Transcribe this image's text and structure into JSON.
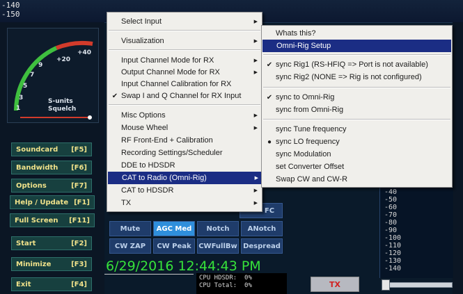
{
  "levels": {
    "top1": "-140",
    "top2": "-150"
  },
  "smeter": {
    "scale": [
      "+20",
      "+40",
      "9",
      "7",
      "5",
      "3",
      "1"
    ],
    "label1": "S-units",
    "label2": "Squelch"
  },
  "leftpanel": {
    "buttons": [
      {
        "label": "Soundcard",
        "key": "[F5]"
      },
      {
        "label": "Bandwidth",
        "key": "[F6]"
      },
      {
        "label": "Options",
        "key": "[F7]"
      },
      {
        "label": "Help / Update",
        "key": "[F1]"
      },
      {
        "label": "Full Screen",
        "key": "[F11]"
      },
      {
        "label": "Start",
        "key": "[F2]"
      },
      {
        "label": "Minimize",
        "key": "[F3]"
      },
      {
        "label": "Exit",
        "key": "[F4]"
      }
    ]
  },
  "midbuttons": {
    "row1": [
      "Mute",
      "AGC Med",
      "Notch",
      "ANotch"
    ],
    "row2": [
      "CW ZAP",
      "CW Peak",
      "CWFullBw",
      "Despread"
    ],
    "partial": "FC"
  },
  "clock": "6/29/2016 12:44:43 PM",
  "cpu": {
    "line1": "CPU HDSDR:  0%",
    "line2": "CPU Total:  0%"
  },
  "tx_label": "TX",
  "scale_ticks": [
    "-40",
    "-50",
    "-60",
    "-70",
    "-80",
    "-90",
    "-100",
    "-110",
    "-120",
    "-130",
    "-140"
  ],
  "main_menu": {
    "items": [
      {
        "label": "Select Input",
        "submenu": true
      },
      {
        "label": "Visualization",
        "submenu": true
      },
      {
        "label": "Input Channel Mode for RX",
        "submenu": true
      },
      {
        "label": "Output Channel Mode for RX",
        "submenu": true
      },
      {
        "label": "Input Channel Calibration for RX",
        "submenu": false
      },
      {
        "label": "Swap I and Q Channel for RX Input",
        "submenu": false,
        "checked": true
      },
      {
        "label": "Misc Options",
        "submenu": true
      },
      {
        "label": "Mouse Wheel",
        "submenu": true
      },
      {
        "label": "RF Front-End + Calibration",
        "submenu": false
      },
      {
        "label": "Recording Settings/Scheduler",
        "submenu": false
      },
      {
        "label": "DDE to HDSDR",
        "submenu": false
      },
      {
        "label": "CAT to Radio (Omni-Rig)",
        "submenu": true,
        "highlighted": true
      },
      {
        "label": "CAT to HDSDR",
        "submenu": true
      },
      {
        "label": "TX",
        "submenu": true
      }
    ]
  },
  "sub_menu": {
    "items": [
      {
        "label": "Whats this?"
      },
      {
        "label": "Omni-Rig Setup",
        "highlighted": true
      },
      {
        "label": "sync Rig1  (RS-HFIQ => Port is not available)",
        "mark": "check"
      },
      {
        "label": "sync Rig2  (NONE => Rig is not configured)"
      },
      {
        "label": "sync to Omni-Rig",
        "mark": "check"
      },
      {
        "label": "sync from Omni-Rig"
      },
      {
        "label": "sync Tune frequency"
      },
      {
        "label": "sync LO frequency",
        "mark": "dot"
      },
      {
        "label": "sync Modulation"
      },
      {
        "label": "set Converter Offset"
      },
      {
        "label": "Swap CW and CW-R"
      }
    ]
  }
}
